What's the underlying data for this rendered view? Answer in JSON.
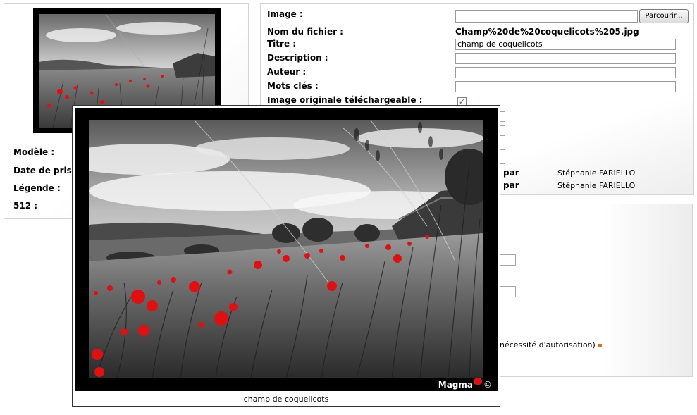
{
  "left_panel": {
    "meta_labels": [
      "Modèle :",
      "Date de prise",
      "Légende :",
      "512 :"
    ]
  },
  "form": {
    "image_label": "Image :",
    "browse_label": "Parcourir...",
    "filename_label": "Nom du fichier :",
    "filename_value": "Champ%20de%20coquelicots%205.jpg",
    "title_label": "Titre :",
    "title_value": "champ de coquelicots",
    "description_label": "Description :",
    "description_value": "",
    "author_label": "Auteur :",
    "author_value": "",
    "keywords_label": "Mots clés :",
    "keywords_value": "",
    "downloadable_label": "Image originale téléchargeable :",
    "downloadable_checked": true,
    "checkmark_glyph": "✓",
    "credits": [
      {
        "label": "par",
        "name": "Stéphanie FARIELLO"
      },
      {
        "label": "par",
        "name": "Stéphanie FARIELLO"
      }
    ]
  },
  "lower_panel": {
    "note": "nécessité d'autorisation)"
  },
  "popup": {
    "caption": "champ de coquelicots",
    "watermark": "Magma",
    "copyright": "©"
  },
  "colors": {
    "poppy_red": "#e01010",
    "checkbox_green": "#2e8b2e",
    "accent_orange": "#e07020"
  }
}
